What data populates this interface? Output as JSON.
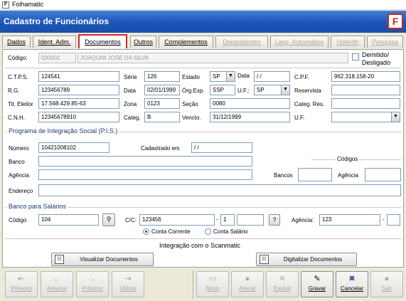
{
  "window": {
    "title": "Folhamatic",
    "app_icon": "F"
  },
  "header": {
    "title": "Cadastro de Funcionários",
    "logo": "F",
    "brand_color": "#1c55b8"
  },
  "tabs": [
    {
      "label": "Dados",
      "state": "normal"
    },
    {
      "label": "Ident. Adm.",
      "state": "normal"
    },
    {
      "label": "Documentos",
      "state": "active"
    },
    {
      "label": "Outros",
      "state": "normal"
    },
    {
      "label": "Complementos",
      "state": "normal"
    },
    {
      "label": "Dependentes",
      "state": "disabled"
    },
    {
      "label": "Lanç. Automático",
      "state": "disabled"
    },
    {
      "label": "Holerith",
      "state": "disabled"
    },
    {
      "label": "Pesquisa",
      "state": "disabled"
    }
  ],
  "employee": {
    "code_label": "Código:",
    "code": "000001",
    "name": "JOAQUIM JOSE DA SILVA",
    "dismissed_label": "Demitido/ Desligado",
    "dismissed": false
  },
  "documents": {
    "ctps_label": "C.T.P.S.",
    "ctps": "124541",
    "serie_label": "Série",
    "serie": "126",
    "estado_label": "Estado",
    "estado": "SP",
    "data_label": "Data",
    "data_ctps": " /  /",
    "cpf_label": "C.P.F.",
    "cpf": "962.318.158-20",
    "rg_label": "R.G.",
    "rg": "123456789",
    "data_rg_label": "Data",
    "data_rg": "02/01/1999",
    "orgexp_label": "Órg.Exp.",
    "orgexp": "SSP",
    "uf_label": "U.F.:",
    "uf": "SP",
    "reservista_label": "Reservista",
    "reservista": "",
    "titulo_label": "Tit. Eleitor",
    "titulo": "17.568.429.85-63",
    "zona_label": "Zona",
    "zona": "0123",
    "secao_label": "Seção",
    "secao": "0080",
    "categ_res_label": "Categ.  Res.",
    "categ_res": "",
    "cnh_label": "C.N.H.",
    "cnh": "12345678910",
    "categ_label": "Categ.",
    "categ": "B",
    "vencto_label": "Vencto.",
    "vencto": "31/12/1999",
    "uf2_label": "U.F.",
    "uf2": ""
  },
  "pis": {
    "section_title": "Programa de Integração Social (P.I.S.)",
    "numero_label": "Número",
    "numero": "10421008102",
    "cadastrado_label": "Cadastrado em",
    "cadastrado": " /  /",
    "banco_label": "Banco",
    "banco": "",
    "agencia_label": "Agência",
    "agencia": "",
    "endereco_label": "Endereço",
    "endereco": "",
    "codigos_title": "Códigos",
    "cod_bancos_label": "Bancos",
    "cod_bancos": "",
    "cod_agencia_label": "Agência",
    "cod_agencia": ""
  },
  "salary_bank": {
    "section_title": "Banco para Salários",
    "codigo_label": "Código",
    "codigo": "104",
    "search_icon": "magnifier-icon",
    "cc_label": "C/C:",
    "cc": "123456",
    "cc_sep": "-",
    "cc_digit": "1",
    "cc_extra": "",
    "help_label": "?",
    "agencia_label": "Agência:",
    "agencia": "123",
    "agencia_sep": "-",
    "agencia_digit": "",
    "account_types": [
      {
        "label": "Conta Corrente",
        "selected": true
      },
      {
        "label": "Conta Salário",
        "selected": false
      }
    ]
  },
  "scanmatic": {
    "title": "Integração com o Scanmatic",
    "view_label": "Visualizar Documentos",
    "scan_label": "Digitalizar Documentos"
  },
  "navigation": [
    {
      "label": "Primeiro",
      "icon": "first-record-icon",
      "glyph": "⇤",
      "enabled": false
    },
    {
      "label": "Anterior",
      "icon": "previous-record-icon",
      "glyph": "←",
      "enabled": false
    },
    {
      "label": "Próximo",
      "icon": "next-record-icon",
      "glyph": "→",
      "enabled": false
    },
    {
      "label": "Último",
      "icon": "last-record-icon",
      "glyph": "⇥",
      "enabled": false
    }
  ],
  "actions": [
    {
      "label": "Novo",
      "icon": "new-record-icon",
      "glyph": "▭",
      "enabled": false
    },
    {
      "label": "Alterar",
      "icon": "edit-record-icon",
      "glyph": "●",
      "enabled": false
    },
    {
      "label": "Excluir",
      "icon": "delete-record-icon",
      "glyph": "✕",
      "enabled": false
    },
    {
      "label": "Gravar",
      "icon": "save-record-icon",
      "glyph": "✎",
      "enabled": true
    },
    {
      "label": "Cancelar",
      "icon": "cancel-icon",
      "glyph": "✖",
      "enabled": true
    },
    {
      "label": "Sair",
      "icon": "exit-icon",
      "glyph": "●",
      "enabled": false
    }
  ]
}
